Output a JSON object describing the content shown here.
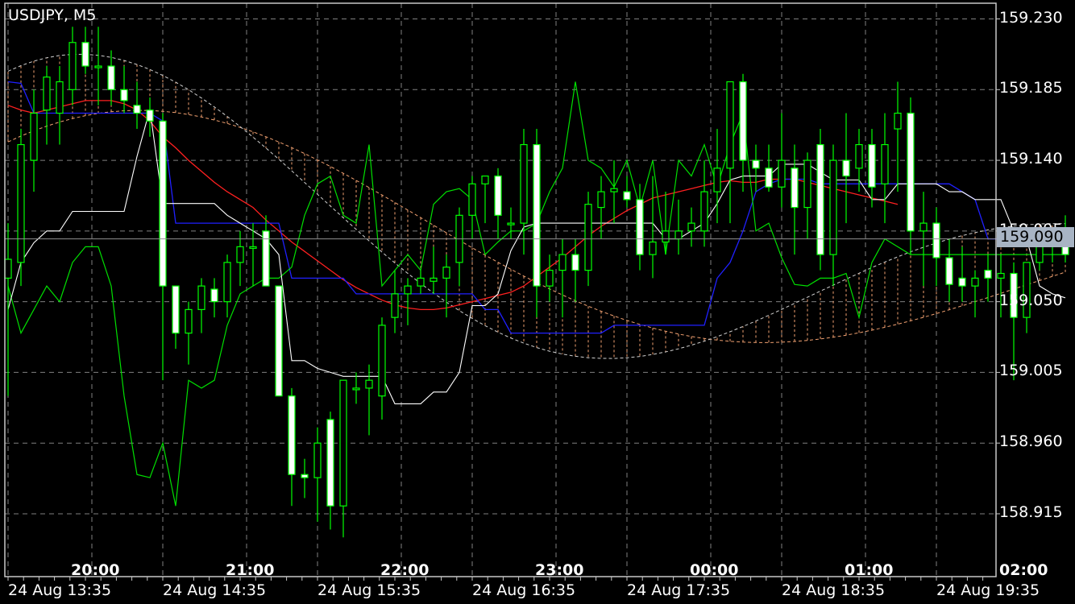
{
  "chart_data": {
    "type": "candlestick",
    "symbol": "USDJPY, M5",
    "current_price": "159.090",
    "price_axis": [
      "159.230",
      "159.185",
      "159.140",
      "159.095",
      "159.050",
      "159.005",
      "158.960",
      "158.915"
    ],
    "time_axis": [
      "20:00",
      "21:00",
      "22:00",
      "23:00",
      "00:00",
      "01:00",
      "02:00"
    ],
    "date_axis": [
      "24 Aug 13:35",
      "24 Aug 14:35",
      "24 Aug 15:35",
      "24 Aug 16:35",
      "24 Aug 17:35",
      "24 Aug 18:35",
      "24 Aug 19:35"
    ],
    "ylim": [
      158.875,
      159.24
    ],
    "grid": true,
    "colors": {
      "background": "#000000",
      "grid": "#808080",
      "bull_candle": "#000000",
      "bear_candle": "#ffffff",
      "wick": "#00ff00",
      "tenkan": "#ff2020",
      "kijun": "#2020ff",
      "chikou": "#00e000",
      "span": "#ffffff",
      "cloud": "#f0a070",
      "current_price_bg": "#a8b4c4"
    },
    "candles": [
      [
        159.065,
        159.1,
        158.99,
        159.077
      ],
      [
        159.075,
        159.16,
        159.06,
        159.15
      ],
      [
        159.14,
        159.185,
        159.12,
        159.17
      ],
      [
        159.172,
        159.2,
        159.15,
        159.193
      ],
      [
        159.17,
        159.2,
        159.15,
        159.19
      ],
      [
        159.185,
        159.225,
        159.175,
        159.215
      ],
      [
        159.215,
        159.225,
        159.195,
        159.2
      ],
      [
        159.2,
        159.225,
        159.175,
        159.2
      ],
      [
        159.2,
        159.21,
        159.175,
        159.185
      ],
      [
        159.185,
        159.2,
        159.17,
        159.178
      ],
      [
        159.175,
        159.19,
        159.16,
        159.17
      ],
      [
        159.172,
        159.18,
        159.155,
        159.165
      ],
      [
        159.165,
        159.17,
        159.0,
        159.06
      ],
      [
        159.06,
        159.06,
        159.02,
        159.03
      ],
      [
        159.03,
        159.05,
        159.01,
        159.045
      ],
      [
        159.045,
        159.065,
        159.03,
        159.06
      ],
      [
        159.058,
        159.065,
        159.04,
        159.05
      ],
      [
        159.05,
        159.08,
        159.04,
        159.075
      ],
      [
        159.075,
        159.095,
        159.06,
        159.085
      ],
      [
        159.085,
        159.1,
        159.06,
        159.085
      ],
      [
        159.095,
        159.105,
        159.06,
        159.06
      ],
      [
        159.06,
        159.06,
        158.99,
        158.99
      ],
      [
        158.99,
        158.995,
        158.92,
        158.94
      ],
      [
        158.94,
        158.95,
        158.925,
        158.938
      ],
      [
        158.938,
        158.97,
        158.91,
        158.96
      ],
      [
        158.975,
        158.98,
        158.905,
        158.92
      ],
      [
        158.92,
        159.0,
        158.9,
        159.0
      ],
      [
        158.995,
        159.005,
        158.985,
        158.995
      ],
      [
        158.995,
        159.01,
        158.965,
        159.0
      ],
      [
        158.99,
        159.04,
        158.975,
        159.035
      ],
      [
        159.04,
        159.07,
        159.03,
        159.055
      ],
      [
        159.055,
        159.065,
        159.035,
        159.06
      ],
      [
        159.06,
        159.07,
        159.055,
        159.065
      ],
      [
        159.063,
        159.085,
        159.055,
        159.065
      ],
      [
        159.065,
        159.08,
        159.04,
        159.072
      ],
      [
        159.075,
        159.11,
        159.06,
        159.105
      ],
      [
        159.105,
        159.13,
        159.09,
        159.125
      ],
      [
        159.125,
        159.13,
        159.1,
        159.13
      ],
      [
        159.13,
        159.135,
        159.09,
        159.105
      ],
      [
        159.1,
        159.11,
        159.09,
        159.1
      ],
      [
        159.1,
        159.16,
        159.08,
        159.15
      ],
      [
        159.15,
        159.16,
        159.04,
        159.06
      ],
      [
        159.06,
        159.08,
        159.05,
        159.07
      ],
      [
        159.07,
        159.09,
        159.04,
        159.08
      ],
      [
        159.08,
        159.09,
        159.05,
        159.07
      ],
      [
        159.07,
        159.12,
        159.06,
        159.112
      ],
      [
        159.11,
        159.13,
        159.09,
        159.12
      ],
      [
        159.12,
        159.14,
        159.1,
        159.122
      ],
      [
        159.12,
        159.13,
        159.11,
        159.115
      ],
      [
        159.115,
        159.125,
        159.07,
        159.08
      ],
      [
        159.08,
        159.13,
        159.065,
        159.088
      ],
      [
        159.088,
        159.12,
        159.08,
        159.095
      ],
      [
        159.09,
        159.115,
        159.08,
        159.095
      ],
      [
        159.095,
        159.11,
        159.085,
        159.1
      ],
      [
        159.095,
        159.14,
        159.085,
        159.12
      ],
      [
        159.12,
        159.16,
        159.1,
        159.135
      ],
      [
        159.135,
        159.19,
        159.1,
        159.19
      ],
      [
        159.19,
        159.195,
        159.12,
        159.14
      ],
      [
        159.14,
        159.15,
        159.12,
        159.135
      ],
      [
        159.135,
        159.15,
        159.12,
        159.123
      ],
      [
        159.123,
        159.17,
        159.11,
        159.14
      ],
      [
        159.135,
        159.15,
        159.08,
        159.11
      ],
      [
        159.11,
        159.145,
        159.09,
        159.14
      ],
      [
        159.15,
        159.16,
        159.07,
        159.08
      ],
      [
        159.08,
        159.15,
        159.06,
        159.14
      ],
      [
        159.14,
        159.17,
        159.1,
        159.13
      ],
      [
        159.135,
        159.16,
        159.12,
        159.15
      ],
      [
        159.15,
        159.16,
        159.11,
        159.123
      ],
      [
        159.125,
        159.17,
        159.1,
        159.15
      ],
      [
        159.16,
        159.19,
        159.12,
        159.17
      ],
      [
        159.17,
        159.18,
        159.08,
        159.095
      ],
      [
        159.095,
        159.12,
        159.06,
        159.1
      ],
      [
        159.1,
        159.11,
        159.06,
        159.078
      ],
      [
        159.078,
        159.09,
        159.05,
        159.061
      ],
      [
        159.065,
        159.085,
        159.05,
        159.06
      ],
      [
        159.06,
        159.07,
        159.04,
        159.065
      ],
      [
        159.07,
        159.08,
        159.05,
        159.065
      ],
      [
        159.065,
        159.08,
        159.04,
        159.068
      ],
      [
        159.068,
        159.075,
        159.0,
        159.04
      ],
      [
        159.04,
        159.075,
        159.03,
        159.075
      ],
      [
        159.075,
        159.09,
        159.07,
        159.09
      ],
      [
        159.09,
        159.095,
        159.075,
        159.085
      ],
      [
        159.085,
        159.105,
        159.075,
        159.08
      ]
    ],
    "tenkan": [
      159.175,
      159.172,
      159.17,
      159.172,
      159.174,
      159.176,
      159.178,
      159.178,
      159.178,
      159.176,
      159.172,
      159.165,
      159.155,
      159.148,
      159.14,
      159.133,
      159.126,
      159.12,
      159.115,
      159.11,
      159.102,
      159.095,
      159.088,
      159.082,
      159.076,
      159.07,
      159.064,
      159.059,
      159.055,
      159.051,
      159.048,
      159.046,
      159.045,
      159.045,
      159.046,
      159.048,
      159.05,
      159.052,
      159.054,
      159.056,
      159.06,
      159.066,
      159.072,
      159.078,
      159.085,
      159.092,
      159.098,
      159.103,
      159.108,
      159.112,
      159.116,
      159.118,
      159.12,
      159.122,
      159.124,
      159.126,
      159.127,
      159.126,
      159.126,
      159.128,
      159.128,
      159.128,
      159.126,
      159.124,
      159.122,
      159.12,
      159.118,
      159.116,
      159.114,
      159.112
    ],
    "kijun": [
      159.19,
      159.189,
      159.17,
      159.17,
      159.17,
      159.17,
      159.17,
      159.17,
      159.17,
      159.17,
      159.17,
      159.17,
      159.165,
      159.1,
      159.1,
      159.1,
      159.1,
      159.1,
      159.1,
      159.1,
      159.1,
      159.1,
      159.065,
      159.065,
      159.065,
      159.065,
      159.065,
      159.055,
      159.055,
      159.055,
      159.055,
      159.055,
      159.055,
      159.055,
      159.055,
      159.055,
      159.055,
      159.045,
      159.045,
      159.03,
      159.03,
      159.03,
      159.03,
      159.03,
      159.03,
      159.03,
      159.03,
      159.035,
      159.035,
      159.035,
      159.035,
      159.035,
      159.035,
      159.035,
      159.035,
      159.065,
      159.075,
      159.095,
      159.12,
      159.125,
      159.128,
      159.128,
      159.128,
      159.125,
      159.125,
      159.125,
      159.125,
      159.125,
      159.125,
      159.125,
      159.125,
      159.125,
      159.125,
      159.125,
      159.12,
      159.115,
      159.09,
      159.09,
      159.09,
      159.09,
      159.09
    ]
  }
}
